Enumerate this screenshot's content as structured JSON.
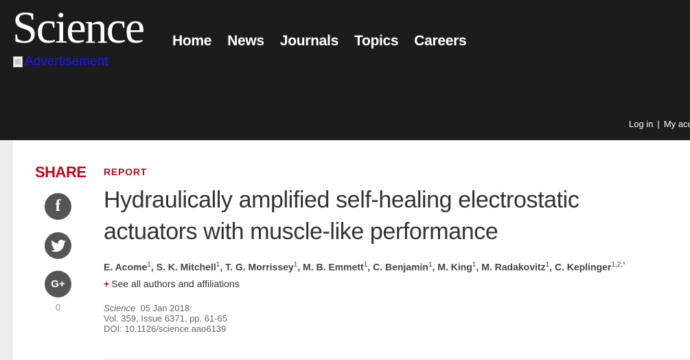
{
  "header": {
    "logo": "Science",
    "nav": [
      "Home",
      "News",
      "Journals",
      "Topics",
      "Careers"
    ],
    "ad_alt": "Advertisement",
    "login": "Log in",
    "separator": "|",
    "account": "My acco"
  },
  "share": {
    "title": "SHARE",
    "icons": [
      "facebook-icon",
      "twitter-icon",
      "google-plus-icon"
    ],
    "count": "0"
  },
  "article": {
    "type": "REPORT",
    "title": "Hydraulically amplified self-healing electrostatic actuators with muscle-like performance",
    "authors": [
      {
        "name": "E. Acome",
        "aff": "1"
      },
      {
        "name": "S. K. Mitchell",
        "aff": "1"
      },
      {
        "name": "T. G. Morrissey",
        "aff": "1"
      },
      {
        "name": "M. B. Emmett",
        "aff": "1"
      },
      {
        "name": "C. Benjamin",
        "aff": "1"
      },
      {
        "name": "M. King",
        "aff": "1"
      },
      {
        "name": "M. Radakovitz",
        "aff": "1"
      },
      {
        "name": "C. Keplinger",
        "aff": "1,2,*"
      }
    ],
    "see_all": "See all authors and affiliations",
    "journal": "Science",
    "date": "05 Jan 2018:",
    "volume": "Vol. 359, Issue 6371, pp. 61-65",
    "doi": "DOI: 10.1126/science.aao6139"
  },
  "colors": {
    "header_bg": "#1c1c1c",
    "accent_red": "#c0091e",
    "ad_link": "#1a1aff"
  }
}
